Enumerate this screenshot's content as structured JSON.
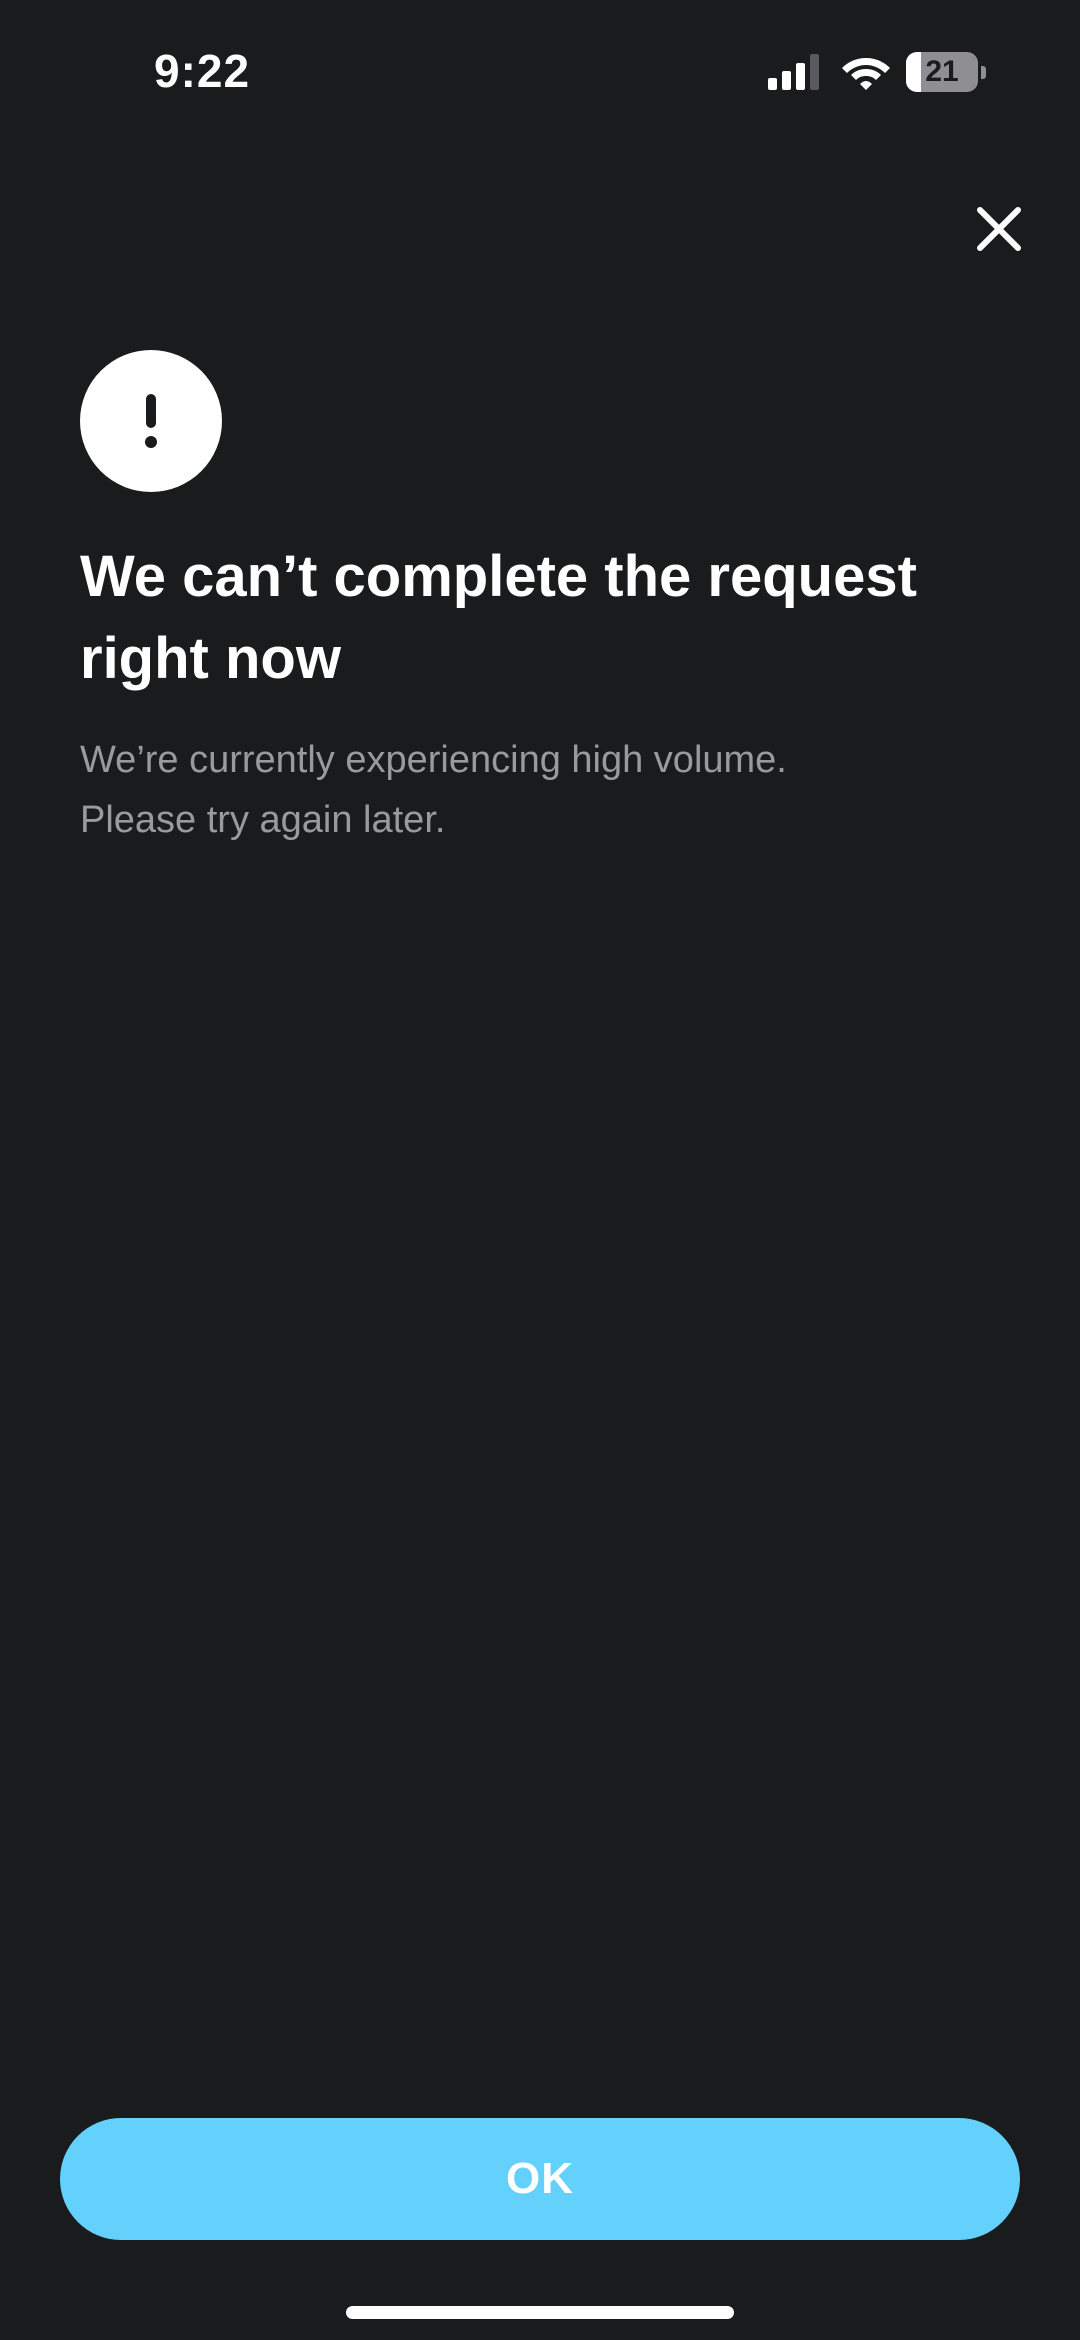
{
  "status_bar": {
    "time": "9:22",
    "battery_level": "21",
    "battery_fraction": 0.21,
    "signal_icon": "cellular-signal-icon",
    "wifi_icon": "wifi-icon"
  },
  "header": {
    "close_icon": "close-icon"
  },
  "alert": {
    "icon": "exclamation-icon",
    "title": "We can’t complete the request right now",
    "message_line1": "We’re currently experiencing high volume.",
    "message_line2": "Please try again later."
  },
  "actions": {
    "ok_label": "OK"
  },
  "colors": {
    "background": "#1a1b1d",
    "accent": "#63d1fb",
    "text_primary": "#ffffff",
    "text_secondary": "#9a9a9e"
  }
}
